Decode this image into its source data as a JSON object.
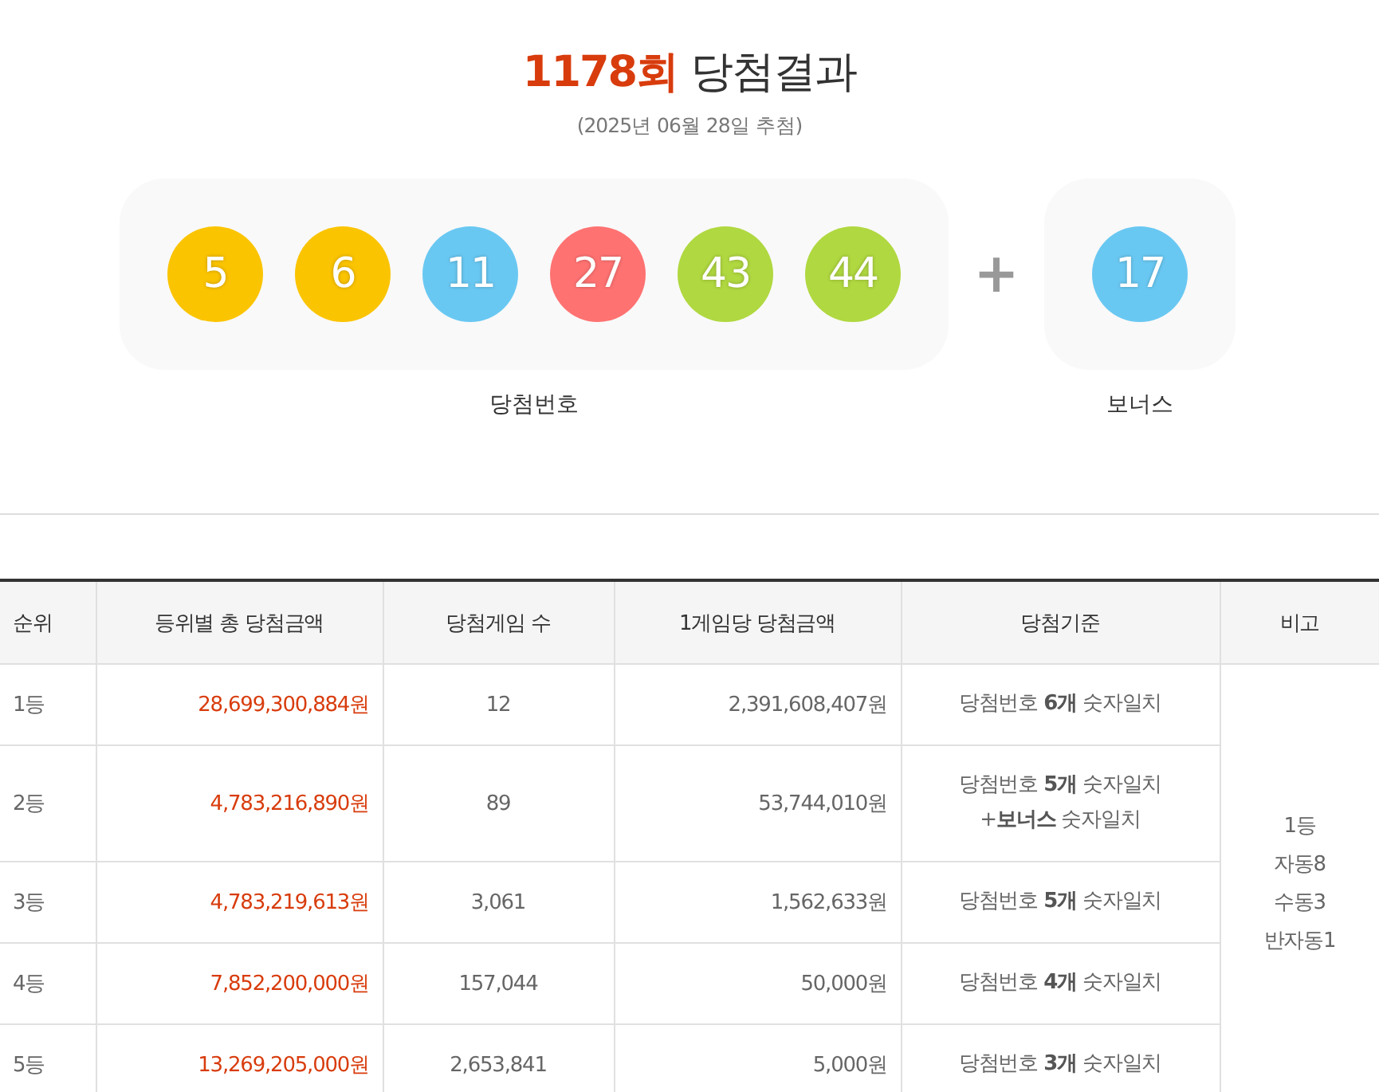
{
  "header": {
    "draw_number": "1178회",
    "title": "당첨결과",
    "date": "(2025년 06월 28일 추첨)"
  },
  "winning_numbers": {
    "label": "당첨번호",
    "balls": [
      {
        "number": "5",
        "color": "#fbc400"
      },
      {
        "number": "6",
        "color": "#fbc400"
      },
      {
        "number": "11",
        "color": "#69c8f2"
      },
      {
        "number": "27",
        "color": "#ff7272"
      },
      {
        "number": "43",
        "color": "#b0d840"
      },
      {
        "number": "44",
        "color": "#b0d840"
      }
    ]
  },
  "plus": "+",
  "bonus": {
    "label": "보너스",
    "ball": {
      "number": "17",
      "color": "#69c8f2"
    }
  },
  "table": {
    "columns": [
      "순위",
      "등위별 총 당첨금액",
      "당첨게임 수",
      "1게임당 당첨금액",
      "당첨기준",
      "비고"
    ],
    "rows": [
      {
        "rank": "1등",
        "total": "28,699,300,884원",
        "winners": "12",
        "per_game": "2,391,608,407원",
        "criteria": [
          "당첨번호 **6개** 숫자일치"
        ]
      },
      {
        "rank": "2등",
        "total": "4,783,216,890원",
        "winners": "89",
        "per_game": "53,744,010원",
        "criteria": [
          "당첨번호 **5개** 숫자일치",
          "+**보너스** 숫자일치"
        ]
      },
      {
        "rank": "3등",
        "total": "4,783,219,613원",
        "winners": "3,061",
        "per_game": "1,562,633원",
        "criteria": [
          "당첨번호 **5개** 숫자일치"
        ]
      },
      {
        "rank": "4등",
        "total": "7,852,200,000원",
        "winners": "157,044",
        "per_game": "50,000원",
        "criteria": [
          "당첨번호 **4개** 숫자일치"
        ]
      },
      {
        "rank": "5등",
        "total": "13,269,205,000원",
        "winners": "2,653,841",
        "per_game": "5,000원",
        "criteria": [
          "당첨번호 **3개** 숫자일치"
        ]
      }
    ],
    "note": [
      "1등",
      "자동8",
      "수동3",
      "반자동1"
    ]
  }
}
